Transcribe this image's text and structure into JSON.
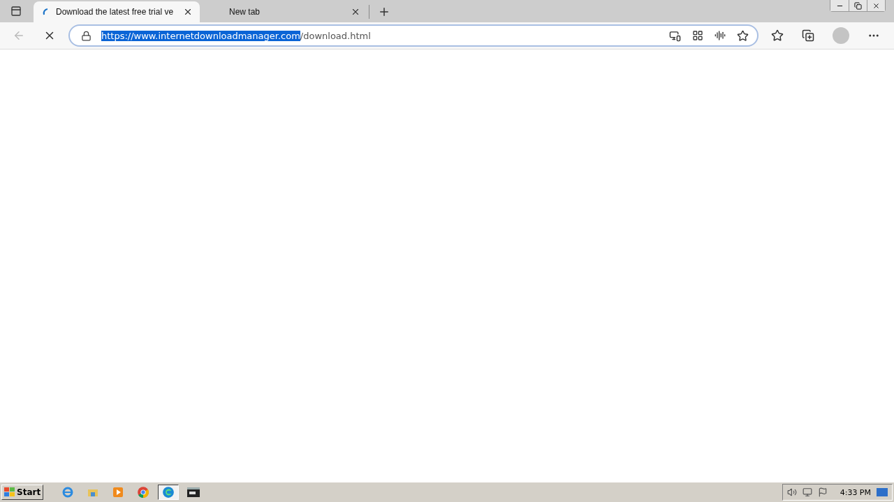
{
  "tabs": [
    {
      "title": "Download the latest free trial ve",
      "loading": true,
      "selected": true
    },
    {
      "title": "New tab",
      "loading": false,
      "selected": false
    }
  ],
  "address_bar": {
    "url_selected": "https://www.internetdownloadmanager.com",
    "url_rest": "/download.html"
  },
  "taskbar": {
    "start": "Start",
    "items": [
      {
        "kind": "ie",
        "selected": false
      },
      {
        "kind": "folder",
        "selected": false
      },
      {
        "kind": "media",
        "selected": false
      },
      {
        "kind": "chrome",
        "selected": false
      },
      {
        "kind": "edge",
        "selected": true
      },
      {
        "kind": "cmd",
        "selected": false
      }
    ],
    "clock": "4:33 PM"
  }
}
